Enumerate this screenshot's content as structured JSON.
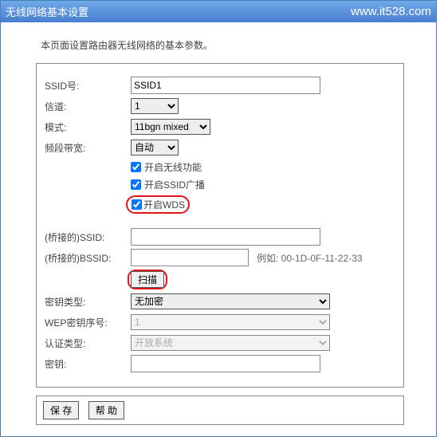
{
  "title": "无线网络基本设置",
  "watermark": "www.it528.com",
  "desc": "本页面设置路由器无线网络的基本参数。",
  "labels": {
    "ssid": "SSID号:",
    "channel": "信道:",
    "mode": "模式:",
    "bandwidth": "频段带宽:",
    "enable_wireless": "开启无线功能",
    "enable_ssid_bcast": "开启SSID广播",
    "enable_wds": "开启WDS",
    "bridge_ssid": "(桥接的)SSID:",
    "bridge_bssid": "(桥接的)BSSID:",
    "bssid_example": "例如: 00-1D-0F-11-22-33",
    "scan": "扫描",
    "key_type": "密钥类型:",
    "wep_index": "WEP密钥序号:",
    "auth_type": "认证类型:",
    "key": "密钥:"
  },
  "values": {
    "ssid": "SSID1",
    "channel": "1",
    "mode": "11bgn mixed",
    "bandwidth": "自动",
    "enable_wireless": true,
    "enable_ssid_bcast": true,
    "enable_wds": true,
    "bridge_ssid": "",
    "bridge_bssid": "",
    "key_type": "无加密",
    "wep_index": "1",
    "auth_type": "开放系统",
    "key": ""
  },
  "buttons": {
    "save": "保 存",
    "help": "帮 助"
  }
}
